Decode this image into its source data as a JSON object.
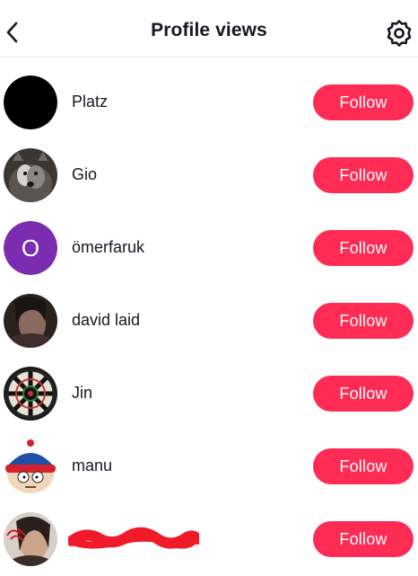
{
  "header": {
    "title": "Profile views",
    "back_icon": "chevron-left-icon",
    "settings_icon": "gear-icon"
  },
  "colors": {
    "accent": "#fe2c55",
    "text": "#161823",
    "divider": "#e9e9ea",
    "avatar_letter_bg": "#7a2db0"
  },
  "viewers": [
    {
      "name": "Platz",
      "button": "Follow"
    },
    {
      "name": "Gio",
      "button": "Follow"
    },
    {
      "name": "ömerfaruk",
      "button": "Follow",
      "avatar_letter": "O"
    },
    {
      "name": "david laid",
      "button": "Follow"
    },
    {
      "name": "Jin",
      "button": "Follow"
    },
    {
      "name": "manu",
      "button": "Follow"
    },
    {
      "name": "",
      "button": "Follow"
    }
  ]
}
